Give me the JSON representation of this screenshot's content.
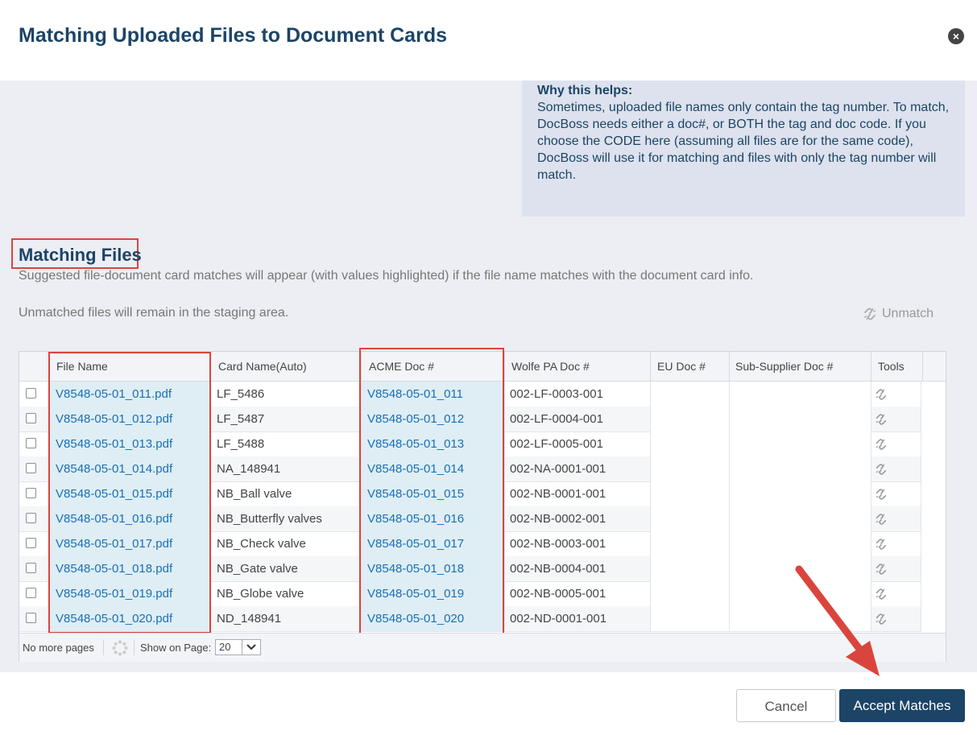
{
  "dialog": {
    "title": "Matching Uploaded Files to Document Cards",
    "close_glyph": "×"
  },
  "help": {
    "title": "Why this helps:",
    "text": "Sometimes, uploaded file names only contain the tag number. To match, DocBoss needs either a doc#, or BOTH the tag and doc code. If you choose the CODE here (assuming all files are for the same code), DocBoss will use it for matching and files with only the tag number will match."
  },
  "section": {
    "title": "Matching Files",
    "desc1": "Suggested file-document card matches will appear (with values highlighted) if the file name matches with the document card info.",
    "desc2": "Unmatched files will remain in the staging area.",
    "unmatch_label": "Unmatch"
  },
  "table": {
    "columns": [
      "File Name",
      "Card Name(Auto)",
      "ACME Doc #",
      "Wolfe PA Doc #",
      "EU Doc #",
      "Sub-Supplier Doc #",
      "Tools"
    ],
    "rows": [
      {
        "file": "V8548-05-01_011.pdf",
        "card": "LF_5486",
        "acme": "V8548-05-01_011",
        "wolfe": "002-LF-0003-001"
      },
      {
        "file": "V8548-05-01_012.pdf",
        "card": "LF_5487",
        "acme": "V8548-05-01_012",
        "wolfe": "002-LF-0004-001"
      },
      {
        "file": "V8548-05-01_013.pdf",
        "card": "LF_5488",
        "acme": "V8548-05-01_013",
        "wolfe": "002-LF-0005-001"
      },
      {
        "file": "V8548-05-01_014.pdf",
        "card": "NA_148941",
        "acme": "V8548-05-01_014",
        "wolfe": "002-NA-0001-001"
      },
      {
        "file": "V8548-05-01_015.pdf",
        "card": "NB_Ball valve",
        "acme": "V8548-05-01_015",
        "wolfe": "002-NB-0001-001"
      },
      {
        "file": "V8548-05-01_016.pdf",
        "card": "NB_Butterfly valves",
        "acme": "V8548-05-01_016",
        "wolfe": "002-NB-0002-001"
      },
      {
        "file": "V8548-05-01_017.pdf",
        "card": "NB_Check valve",
        "acme": "V8548-05-01_017",
        "wolfe": "002-NB-0003-001"
      },
      {
        "file": "V8548-05-01_018.pdf",
        "card": "NB_Gate valve",
        "acme": "V8548-05-01_018",
        "wolfe": "002-NB-0004-001"
      },
      {
        "file": "V8548-05-01_019.pdf",
        "card": "NB_Globe valve",
        "acme": "V8548-05-01_019",
        "wolfe": "002-NB-0005-001"
      },
      {
        "file": "V8548-05-01_020.pdf",
        "card": "ND_148941",
        "acme": "V8548-05-01_020",
        "wolfe": "002-ND-0001-001"
      }
    ]
  },
  "pager": {
    "status": "No more pages",
    "show_label": "Show on Page:",
    "page_size": "20"
  },
  "buttons": {
    "cancel": "Cancel",
    "accept": "Accept Matches"
  },
  "colors": {
    "title": "#1c4466",
    "link": "#1b6fb5",
    "highlight": "#deeef4",
    "annotation_red": "#d9453d",
    "primary_button": "#1c4466"
  },
  "icons": {
    "close": "close-icon",
    "unmatch": "broken-link-icon",
    "refresh": "refresh-spinner-icon",
    "select": "chevron-down-icon",
    "annotation": "arrow-annotation"
  }
}
